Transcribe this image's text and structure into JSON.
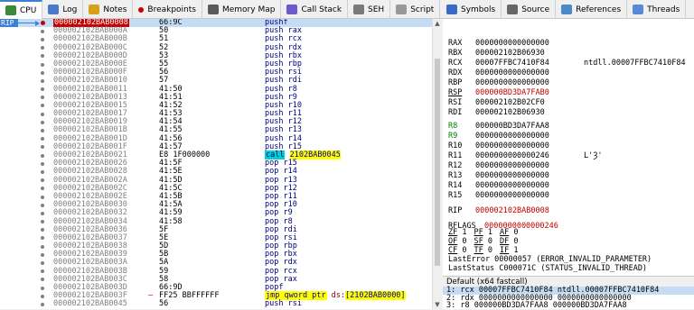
{
  "left_tabs": [
    {
      "label": "CPU",
      "icon": "cpu-icon",
      "active": true
    },
    {
      "label": "Log",
      "icon": "log-icon"
    },
    {
      "label": "Notes",
      "icon": "notes-icon"
    },
    {
      "label": "Breakpoints",
      "icon": "breakpoint-dot-icon"
    },
    {
      "label": "Memory Map",
      "icon": "memory-map-icon"
    },
    {
      "label": "Call Stack",
      "icon": "call-stack-icon"
    },
    {
      "label": "SEH",
      "icon": "seh-icon"
    },
    {
      "label": "Script",
      "icon": "script-icon"
    }
  ],
  "right_tabs": [
    {
      "label": "Symbols",
      "icon": "symbols-icon"
    },
    {
      "label": "Source",
      "icon": "source-icon"
    },
    {
      "label": "References",
      "icon": "references-icon"
    },
    {
      "label": "Threads",
      "icon": "threads-icon"
    }
  ],
  "rip_label": "RIP",
  "disasm": [
    {
      "addr": "000002102BAB0008",
      "bytes": "66:9C",
      "op": "pushf",
      "sel": true
    },
    {
      "addr": "000002102BAB000A",
      "bytes": "50",
      "op": "push rax"
    },
    {
      "addr": "000002102BAB000B",
      "bytes": "51",
      "op": "push rcx"
    },
    {
      "addr": "000002102BAB000C",
      "bytes": "52",
      "op": "push rdx"
    },
    {
      "addr": "000002102BAB000D",
      "bytes": "53",
      "op": "push rbx"
    },
    {
      "addr": "000002102BAB000E",
      "bytes": "55",
      "op": "push rbp"
    },
    {
      "addr": "000002102BAB000F",
      "bytes": "56",
      "op": "push rsi"
    },
    {
      "addr": "000002102BAB0010",
      "bytes": "57",
      "op": "push rdi"
    },
    {
      "addr": "000002102BAB0011",
      "bytes": "41:50",
      "op": "push r8"
    },
    {
      "addr": "000002102BAB0013",
      "bytes": "41:51",
      "op": "push r9"
    },
    {
      "addr": "000002102BAB0015",
      "bytes": "41:52",
      "op": "push r10"
    },
    {
      "addr": "000002102BAB0017",
      "bytes": "41:53",
      "op": "push r11"
    },
    {
      "addr": "000002102BAB0019",
      "bytes": "41:54",
      "op": "push r12"
    },
    {
      "addr": "000002102BAB001B",
      "bytes": "41:55",
      "op": "push r13"
    },
    {
      "addr": "000002102BAB001D",
      "bytes": "41:56",
      "op": "push r14"
    },
    {
      "addr": "000002102BAB001F",
      "bytes": "41:57",
      "op": "push r15"
    },
    {
      "addr": "000002102BAB0021",
      "bytes": "E8 1F000000",
      "op": "call",
      "arg": "2102BAB0045",
      "kind": "call"
    },
    {
      "addr": "000002102BAB0026",
      "bytes": "41:5F",
      "op": "pop r15"
    },
    {
      "addr": "000002102BAB0028",
      "bytes": "41:5E",
      "op": "pop r14"
    },
    {
      "addr": "000002102BAB002A",
      "bytes": "41:5D",
      "op": "pop r13"
    },
    {
      "addr": "000002102BAB002C",
      "bytes": "41:5C",
      "op": "pop r12"
    },
    {
      "addr": "000002102BAB002E",
      "bytes": "41:5B",
      "op": "pop r11"
    },
    {
      "addr": "000002102BAB0030",
      "bytes": "41:5A",
      "op": "pop r10"
    },
    {
      "addr": "000002102BAB0032",
      "bytes": "41:59",
      "op": "pop r9"
    },
    {
      "addr": "000002102BAB0034",
      "bytes": "41:58",
      "op": "pop r8"
    },
    {
      "addr": "000002102BAB0036",
      "bytes": "5F",
      "op": "pop rdi"
    },
    {
      "addr": "000002102BAB0037",
      "bytes": "5E",
      "op": "pop rsi"
    },
    {
      "addr": "000002102BAB0038",
      "bytes": "5D",
      "op": "pop rbp"
    },
    {
      "addr": "000002102BAB0039",
      "bytes": "5B",
      "op": "pop rbx"
    },
    {
      "addr": "000002102BAB003A",
      "bytes": "5A",
      "op": "pop rdx"
    },
    {
      "addr": "000002102BAB003B",
      "bytes": "59",
      "op": "pop rcx"
    },
    {
      "addr": "000002102BAB003C",
      "bytes": "58",
      "op": "pop rax"
    },
    {
      "addr": "000002102BAB003D",
      "bytes": "66:9D",
      "op": "popf"
    },
    {
      "addr": "000002102BAB003F",
      "bytes": "FF25 BBFFFFFF",
      "op": "jmp qword ptr",
      "seg": "ds:",
      "arg": "[2102BAB0000]",
      "kind": "jmp",
      "arrow": "–"
    },
    {
      "addr": "000002102BAB0045",
      "bytes": "56",
      "op": "push rsi"
    }
  ],
  "registers": [
    {
      "name": "RAX",
      "value": "0000000000000000"
    },
    {
      "name": "RBX",
      "value": "000002102B06930"
    },
    {
      "name": "RCX",
      "value": "00007FFBC7410F84",
      "comment": "ntdll.00007FFBC7410F84"
    },
    {
      "name": "RDX",
      "value": "0000000000000000"
    },
    {
      "name": "RBP",
      "value": "0000000000000000"
    },
    {
      "name": "RSP",
      "value": "000000BD3DA7FAB0",
      "red": true,
      "underline": true
    },
    {
      "name": "RSI",
      "value": "000002102B02CF0"
    },
    {
      "name": "RDI",
      "value": "000002102B06930"
    },
    {
      "name": "R8",
      "value": "000000BD3DA7FAA8",
      "green": true
    },
    {
      "name": "R9",
      "value": "0000000000000000",
      "green": true
    },
    {
      "name": "R10",
      "value": "0000000000000000"
    },
    {
      "name": "R11",
      "value": "0000000000000246",
      "comment": "L'Ȝ'"
    },
    {
      "name": "R12",
      "value": "0000000000000000"
    },
    {
      "name": "R13",
      "value": "0000000000000000"
    },
    {
      "name": "R14",
      "value": "0000000000000000"
    },
    {
      "name": "R15",
      "value": "0000000000000000"
    },
    {
      "name": "RIP",
      "value": "000002102BAB0008",
      "red": true
    },
    {
      "name": "RFLAGS",
      "value": "0000000000000246",
      "red": true
    }
  ],
  "flags": [
    [
      {
        "n": "ZF",
        "v": "1"
      },
      {
        "n": "PF",
        "v": "1"
      },
      {
        "n": "AF",
        "v": "0"
      }
    ],
    [
      {
        "n": "OF",
        "v": "0"
      },
      {
        "n": "SF",
        "v": "0"
      },
      {
        "n": "DF",
        "v": "0"
      }
    ],
    [
      {
        "n": "CF",
        "v": "0"
      },
      {
        "n": "TF",
        "v": "0"
      },
      {
        "n": "IF",
        "v": "1"
      }
    ]
  ],
  "last_error": "LastError  00000057 (ERROR_INVALID_PARAMETER)",
  "last_status": "LastStatus C000071C (STATUS_INVALID_THREAD)",
  "fastcall_title": "Default (x64 fastcall)",
  "fastcall": [
    {
      "text": "1: rcx 00007FFBC7410F84 ntdll.00007FFBC7410F84",
      "sel": true
    },
    {
      "text": "2: rdx 0000000000000000 0000000000000000"
    },
    {
      "text": "3: r8 000000BD3DA7FAA8 000000BD3DA7FAA8"
    }
  ]
}
